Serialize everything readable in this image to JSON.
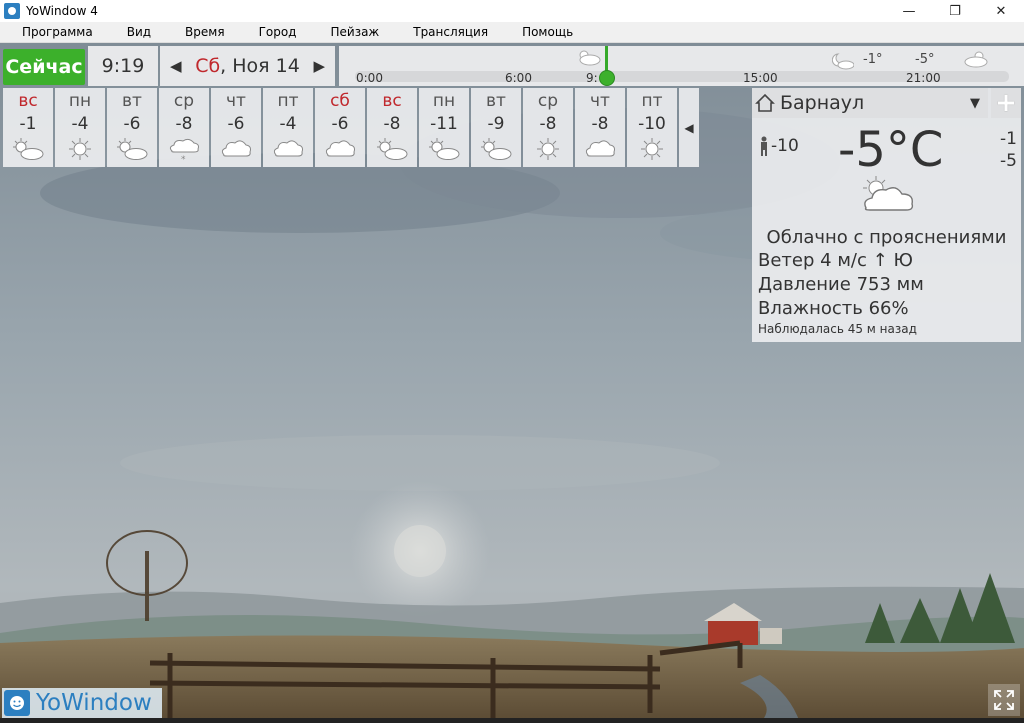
{
  "window": {
    "title": "YoWindow 4",
    "minimize_glyph": "—",
    "maximize_glyph": "❐",
    "close_glyph": "✕"
  },
  "menu": [
    "Программа",
    "Вид",
    "Время",
    "Город",
    "Пейзаж",
    "Трансляция",
    "Помощь"
  ],
  "header": {
    "now_label": "Сейчас",
    "time": "9:19",
    "date_day": "Сб",
    "date_rest": ", Ноя 14"
  },
  "timeline": {
    "labels": [
      "0:00",
      "6:00",
      "9:",
      "15:00",
      "21:00"
    ],
    "temps": [
      "-1°",
      "-5°"
    ]
  },
  "forecast": [
    {
      "day": "вс",
      "temp": "-1",
      "icon": "partly-cloudy-icon",
      "weekend": true
    },
    {
      "day": "пн",
      "temp": "-4",
      "icon": "sun-icon",
      "weekend": false
    },
    {
      "day": "вт",
      "temp": "-6",
      "icon": "partly-cloudy-icon",
      "weekend": false
    },
    {
      "day": "ср",
      "temp": "-8",
      "icon": "snow-cloud-icon",
      "weekend": false
    },
    {
      "day": "чт",
      "temp": "-6",
      "icon": "cloud-icon",
      "weekend": false
    },
    {
      "day": "пт",
      "temp": "-4",
      "icon": "cloud-icon",
      "weekend": false
    },
    {
      "day": "сб",
      "temp": "-6",
      "icon": "cloud-icon",
      "weekend": true
    },
    {
      "day": "вс",
      "temp": "-8",
      "icon": "partly-cloudy-icon",
      "weekend": true
    },
    {
      "day": "пн",
      "temp": "-11",
      "icon": "partly-cloudy-icon",
      "weekend": false
    },
    {
      "day": "вт",
      "temp": "-9",
      "icon": "partly-cloudy-icon",
      "weekend": false
    },
    {
      "day": "ср",
      "temp": "-8",
      "icon": "sun-icon",
      "weekend": false
    },
    {
      "day": "чт",
      "temp": "-8",
      "icon": "cloud-icon",
      "weekend": false
    },
    {
      "day": "пт",
      "temp": "-10",
      "icon": "sun-icon",
      "weekend": false
    }
  ],
  "current": {
    "city": "Барнаул",
    "feels_like": "-10",
    "temperature": "-5°C",
    "high": "-1",
    "low": "-5",
    "condition": "Облачно с прояснениями",
    "wind_label": "Ветер",
    "wind_value": "4 м/с",
    "wind_dir": "Ю",
    "pressure_label": "Давление",
    "pressure_value": "753 мм",
    "humidity_label": "Влажность",
    "humidity_value": "66%",
    "observed": "Наблюдалась 45 м назад"
  },
  "brand": {
    "name": "YoWindow"
  },
  "colors": {
    "accent_green": "#3cb02b",
    "weekend_red": "#c0282d",
    "brand_blue": "#2c7fc0"
  }
}
